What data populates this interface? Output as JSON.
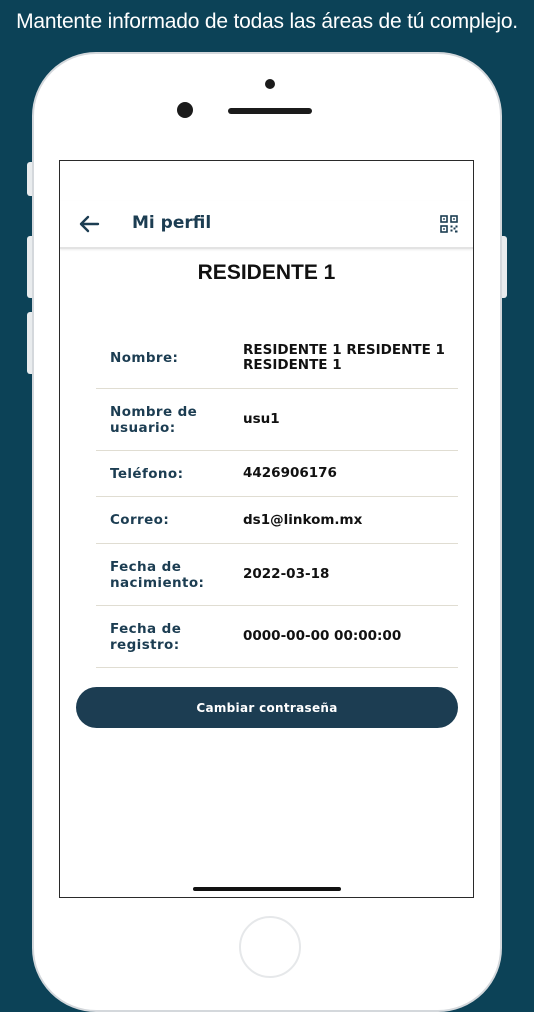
{
  "tagline": "Mantente informado de todas las áreas de tú complejo.",
  "appbar": {
    "title": "Mi perfil",
    "back_icon": "arrow-left-icon",
    "qr_icon": "qr-code-icon"
  },
  "profile": {
    "name_heading": "RESIDENTE 1",
    "fields": [
      {
        "label": "Nombre:",
        "value": "RESIDENTE 1 RESIDENTE 1 RESIDENTE 1"
      },
      {
        "label": "Nombre de usuario:",
        "value": "usu1"
      },
      {
        "label": "Teléfono:",
        "value": "4426906176"
      },
      {
        "label": "Correo:",
        "value": "ds1@linkom.mx"
      },
      {
        "label": "Fecha de nacimiento:",
        "value": "2022-03-18"
      },
      {
        "label": "Fecha de registro:",
        "value": "0000-00-00 00:00:00"
      }
    ]
  },
  "change_password_label": "Cambiar contraseña",
  "colors": {
    "background": "#0c4257",
    "primary": "#1c3d52"
  }
}
